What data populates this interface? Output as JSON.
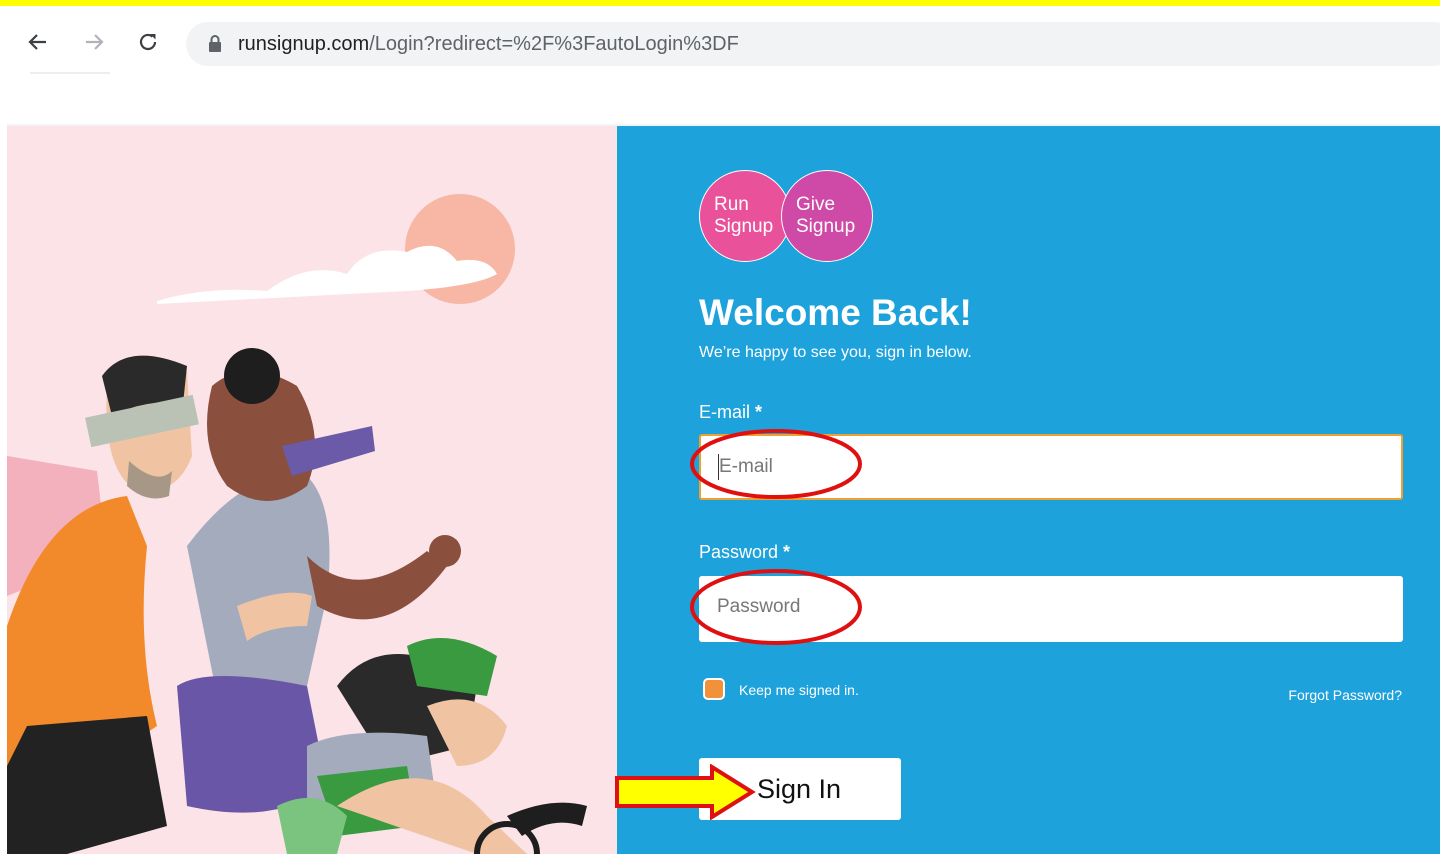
{
  "browser": {
    "url_domain": "runsignup.com",
    "url_path": "/Login?redirect=%2F%3FautoLogin%3DF",
    "icons": [
      "back-arrow-icon",
      "forward-arrow-icon",
      "reload-icon",
      "lock-icon"
    ]
  },
  "logos": {
    "run": [
      "Run",
      "Signup"
    ],
    "give": [
      "Give",
      "Signup"
    ]
  },
  "login": {
    "title": "Welcome Back!",
    "subtitle": "We’re happy to see you, sign in below.",
    "email_label": "E-mail",
    "password_label": "Password",
    "required_mark": "*",
    "email_placeholder": "E-mail",
    "password_placeholder": "Password",
    "keep_signed_in": "Keep me signed in.",
    "forgot_password": "Forgot Password?",
    "sign_in": "Sign In"
  },
  "colors": {
    "highlight_bar": "#ffff00",
    "panel_blue": "#1ea2dc",
    "panel_pink": "#fbe3e8",
    "annotation_red": "#e01010",
    "annotation_arrow": "#ffff00",
    "checkbox_orange": "#f1923b"
  }
}
